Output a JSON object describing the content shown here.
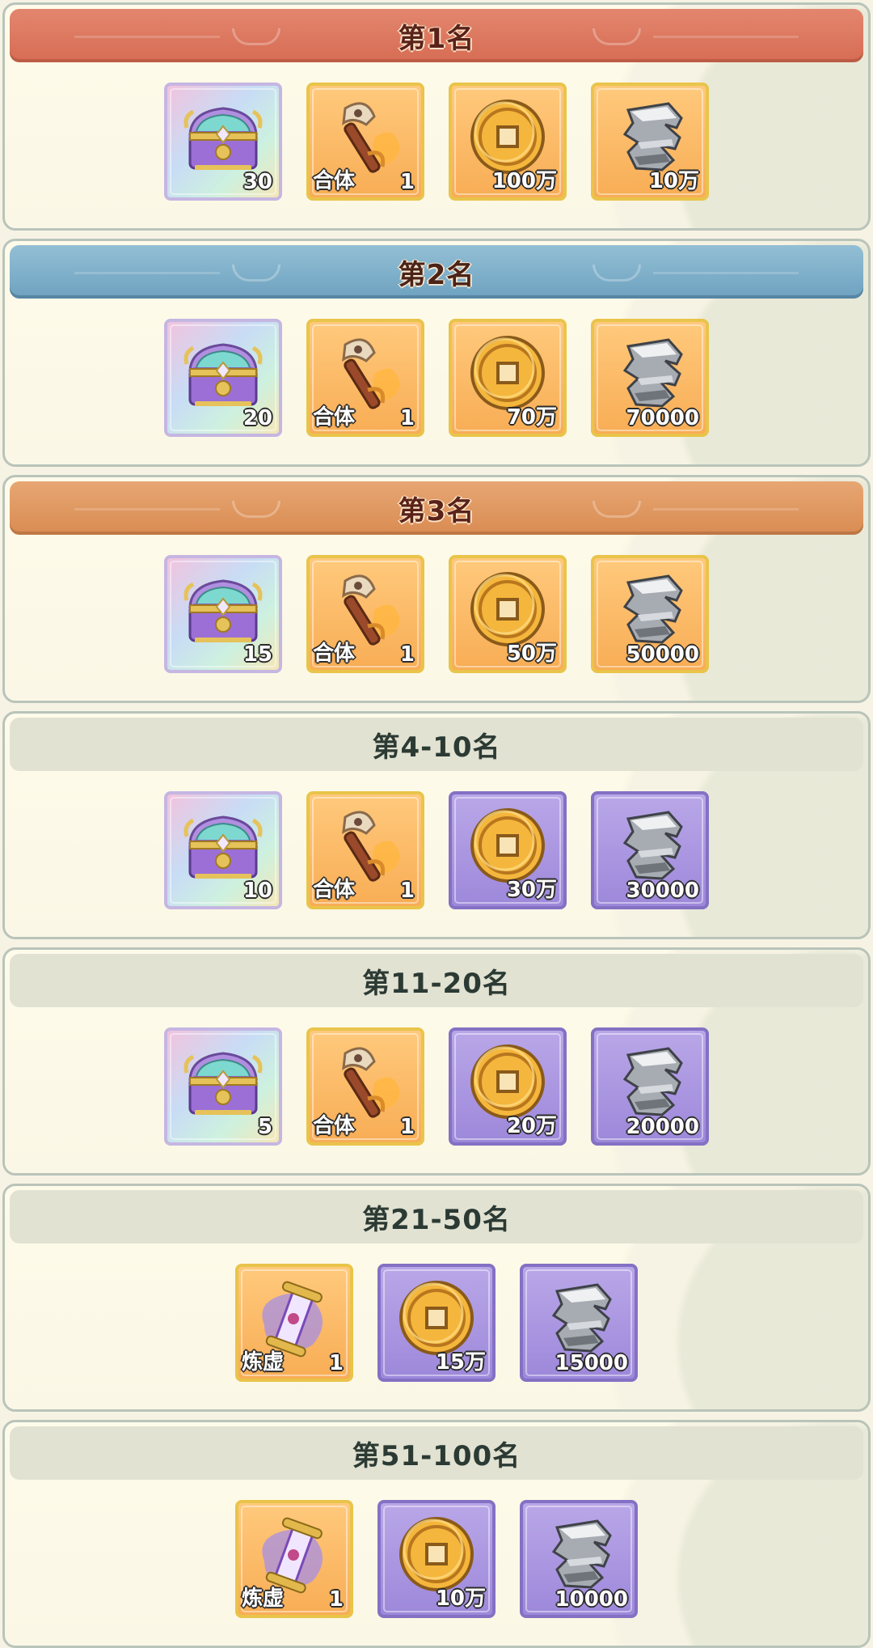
{
  "tiers": [
    {
      "title": "第1名",
      "style": "rank1",
      "items": [
        {
          "icon": "treasure-chest-icon",
          "quality": "rainbow",
          "count": "30",
          "label": ""
        },
        {
          "icon": "hammer-icon",
          "quality": "gold",
          "count": "1",
          "label": "合体"
        },
        {
          "icon": "gold-coin-icon",
          "quality": "gold",
          "count": "100万",
          "label": ""
        },
        {
          "icon": "iron-ore-icon",
          "quality": "gold",
          "count": "10万",
          "label": ""
        }
      ]
    },
    {
      "title": "第2名",
      "style": "rank2",
      "items": [
        {
          "icon": "treasure-chest-icon",
          "quality": "rainbow",
          "count": "20",
          "label": ""
        },
        {
          "icon": "hammer-icon",
          "quality": "gold",
          "count": "1",
          "label": "合体"
        },
        {
          "icon": "gold-coin-icon",
          "quality": "gold",
          "count": "70万",
          "label": ""
        },
        {
          "icon": "iron-ore-icon",
          "quality": "gold",
          "count": "70000",
          "label": ""
        }
      ]
    },
    {
      "title": "第3名",
      "style": "rank3",
      "items": [
        {
          "icon": "treasure-chest-icon",
          "quality": "rainbow",
          "count": "15",
          "label": ""
        },
        {
          "icon": "hammer-icon",
          "quality": "gold",
          "count": "1",
          "label": "合体"
        },
        {
          "icon": "gold-coin-icon",
          "quality": "gold",
          "count": "50万",
          "label": ""
        },
        {
          "icon": "iron-ore-icon",
          "quality": "gold",
          "count": "50000",
          "label": ""
        }
      ]
    },
    {
      "title": "第4-10名",
      "style": "plain",
      "items": [
        {
          "icon": "treasure-chest-icon",
          "quality": "rainbow",
          "count": "10",
          "label": ""
        },
        {
          "icon": "hammer-icon",
          "quality": "gold",
          "count": "1",
          "label": "合体"
        },
        {
          "icon": "gold-coin-icon",
          "quality": "purple",
          "count": "30万",
          "label": ""
        },
        {
          "icon": "iron-ore-icon",
          "quality": "purple",
          "count": "30000",
          "label": ""
        }
      ]
    },
    {
      "title": "第11-20名",
      "style": "plain",
      "items": [
        {
          "icon": "treasure-chest-icon",
          "quality": "rainbow",
          "count": "5",
          "label": ""
        },
        {
          "icon": "hammer-icon",
          "quality": "gold",
          "count": "1",
          "label": "合体"
        },
        {
          "icon": "gold-coin-icon",
          "quality": "purple",
          "count": "20万",
          "label": ""
        },
        {
          "icon": "iron-ore-icon",
          "quality": "purple",
          "count": "20000",
          "label": ""
        }
      ]
    },
    {
      "title": "第21-50名",
      "style": "plain",
      "items": [
        {
          "icon": "scroll-icon",
          "quality": "gold",
          "count": "1",
          "label": "炼虚"
        },
        {
          "icon": "gold-coin-icon",
          "quality": "purple",
          "count": "15万",
          "label": ""
        },
        {
          "icon": "iron-ore-icon",
          "quality": "purple",
          "count": "15000",
          "label": ""
        }
      ]
    },
    {
      "title": "第51-100名",
      "style": "plain",
      "items": [
        {
          "icon": "scroll-icon",
          "quality": "gold",
          "count": "1",
          "label": "炼虚"
        },
        {
          "icon": "gold-coin-icon",
          "quality": "purple",
          "count": "10万",
          "label": ""
        },
        {
          "icon": "iron-ore-icon",
          "quality": "purple",
          "count": "10000",
          "label": ""
        }
      ]
    }
  ]
}
